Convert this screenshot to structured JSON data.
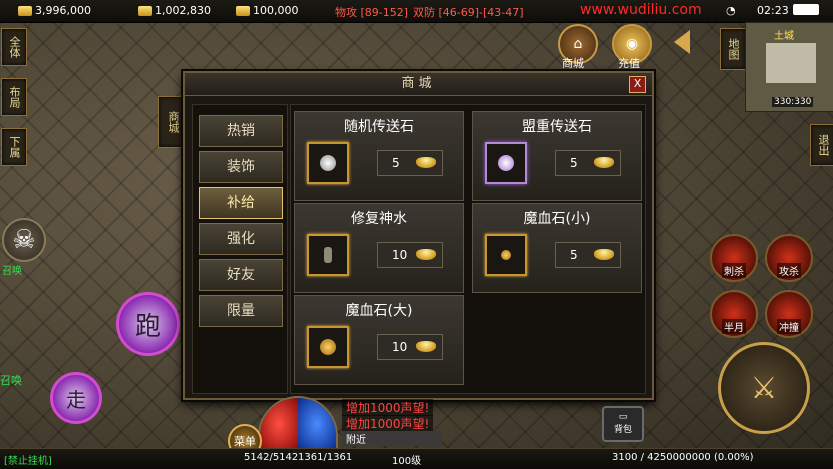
{
  "top_bar": {
    "gold": "3,996,000",
    "bound_gold": "1,002,830",
    "ingots": "100,000",
    "physical_attack": "物攻 [89-152]",
    "defense": "双防 [46-69]-[43-47]",
    "watermark": "www.wudiliu.com",
    "time": "02:23",
    "map_label": "土城"
  },
  "left_side": {
    "btn_all": "全体",
    "btn_layout": "布局",
    "btn_bottom": "下属",
    "run_label": "跑",
    "walk_label": "走",
    "summon_label": "召唤"
  },
  "right_side": {
    "shop_label": "商城",
    "recharge_label": "充值",
    "map_btn": "地图",
    "exit_btn": "退出",
    "coords": "330:330"
  },
  "shop_tab_label": "商城",
  "shop": {
    "title": "商城",
    "close": "X",
    "categories": [
      "热销",
      "装饰",
      "补给",
      "强化",
      "好友",
      "限量"
    ],
    "active_category": "补给",
    "items": [
      {
        "name": "随机传送石",
        "price": "5"
      },
      {
        "name": "盟重传送石",
        "price": "5"
      },
      {
        "name": "修复神水",
        "price": "10"
      },
      {
        "name": "魔血石(小)",
        "price": "5"
      },
      {
        "name": "魔血石(大)",
        "price": "10"
      }
    ]
  },
  "skills": {
    "s1": "刺杀",
    "s2": "攻杀",
    "s3": "半月",
    "s4": "冲撞"
  },
  "chat": {
    "line1": "增加1000声望!",
    "line2": "增加1000声望!",
    "nearby": "附近"
  },
  "bottom": {
    "auto": "[禁止挂机]",
    "hp": "5142/5142",
    "mp": "1361/1361",
    "level": "100级",
    "exp": "3100 / 4250000000 (0.00%)",
    "menu": "菜单",
    "bag": "背包"
  }
}
